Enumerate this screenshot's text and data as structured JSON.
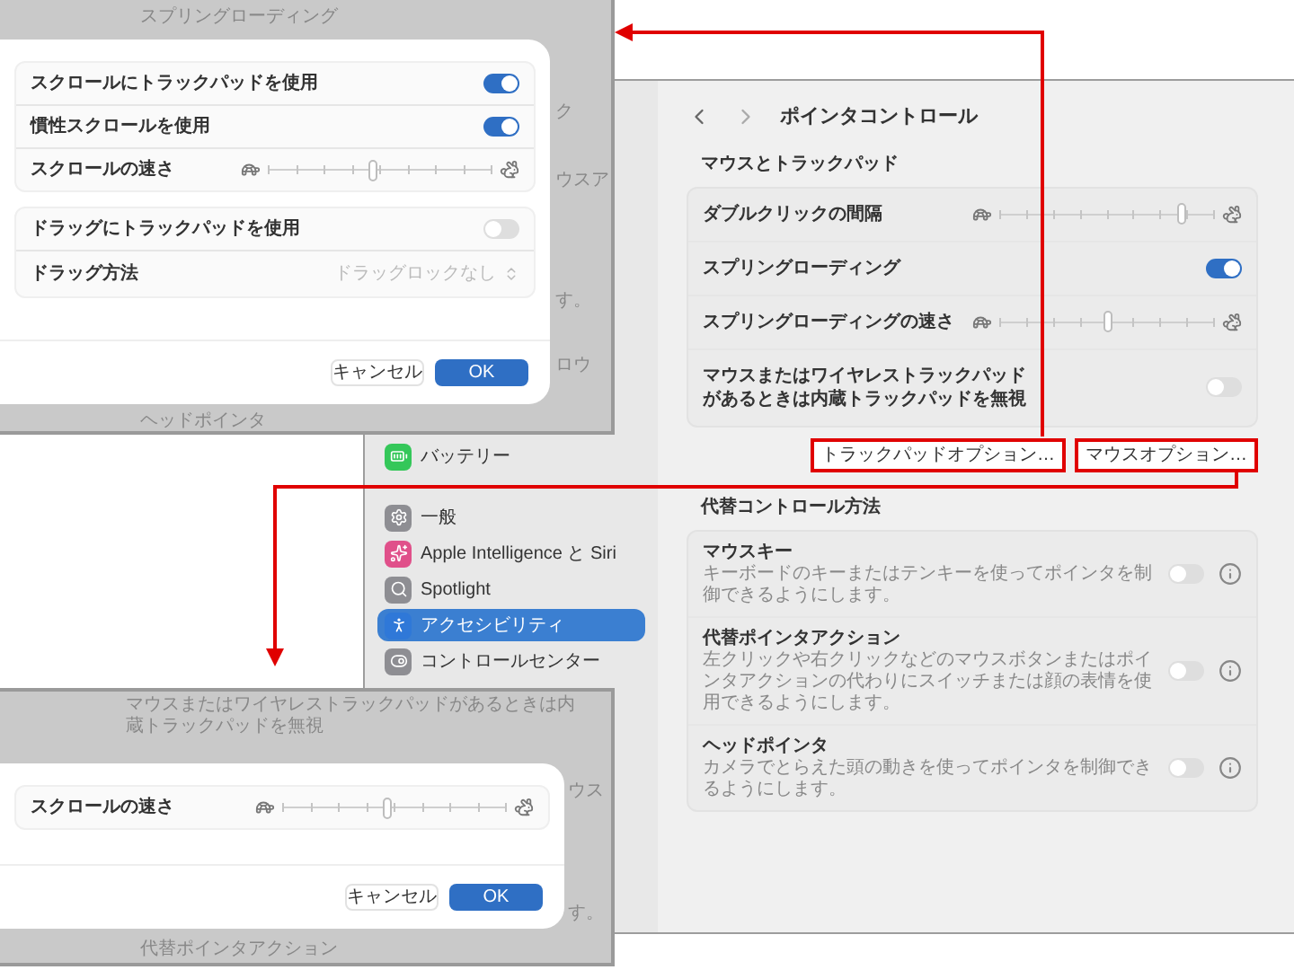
{
  "top_window": {
    "backdrop": {
      "header": "スプリングローディング",
      "fragments": [
        "ク",
        "ウスア",
        "す。",
        "ロウ"
      ],
      "footer": "ヘッドポインタ"
    },
    "sheet": {
      "groups": [
        [
          {
            "kind": "toggle",
            "label": "スクロールにトラックパッドを使用",
            "on": true
          },
          {
            "kind": "toggle",
            "label": "慣性スクロールを使用",
            "on": true
          },
          {
            "kind": "slider",
            "label": "スクロールの速さ",
            "level": 0.46
          }
        ],
        [
          {
            "kind": "toggle",
            "label": "ドラッグにトラックパッドを使用",
            "on": false
          },
          {
            "kind": "popup",
            "label": "ドラッグ方法",
            "value": "ドラッグロックなし",
            "disabled": true
          }
        ]
      ],
      "buttons": [
        {
          "label": "キャンセル",
          "kind": "secondary"
        },
        {
          "label": "OK",
          "kind": "primary"
        }
      ]
    }
  },
  "main_window": {
    "sidebar": [
      {
        "label": "バッテリー",
        "selected": false
      },
      {
        "label": "一般",
        "selected": false
      },
      {
        "label": "Apple Intelligence と Siri",
        "selected": false
      },
      {
        "label": "Spotlight",
        "selected": false
      },
      {
        "label": "アクセシビリティ",
        "selected": true
      },
      {
        "label": "コントロールセンター",
        "selected": false
      }
    ],
    "title": "ポインタコントロール",
    "sections": [
      {
        "heading": "マウスとトラックパッド",
        "rows": [
          {
            "kind": "slider",
            "label": "ダブルクリックの間隔",
            "level": 0.84
          },
          {
            "kind": "toggle",
            "label": "スプリングローディング",
            "on": true
          },
          {
            "kind": "slider",
            "label": "スプリングローディングの速さ",
            "level": 0.5
          },
          {
            "kind": "toggle",
            "label": "マウスまたはワイヤレストラックパッドがあるときは内蔵トラックパッドを無視",
            "on": false
          }
        ],
        "buttons": [
          {
            "label": "トラックパッドオプション…",
            "highlighted": true
          },
          {
            "label": "マウスオプション…",
            "highlighted": true
          }
        ]
      },
      {
        "heading": "代替コントロール方法",
        "rows": [
          {
            "kind": "toggle_info",
            "label": "マウスキー",
            "description": "キーボードのキーまたはテンキーを使ってポインタを制御できるようにします。",
            "on": false
          },
          {
            "kind": "toggle_info",
            "label": "代替ポインタアクション",
            "description": "左クリックや右クリックなどのマウスボタンまたはポインタアクションの代わりにスイッチまたは顔の表情を使用できるようにします。",
            "on": false
          },
          {
            "kind": "toggle_info",
            "label": "ヘッドポインタ",
            "description": "カメラでとらえた頭の動きを使ってポインタを制御できるようにします。",
            "on": false
          }
        ]
      }
    ]
  },
  "bottom_window": {
    "backdrop": {
      "header": "マウスまたはワイヤレストラックパッドがあるときは内蔵トラックパッドを無視",
      "fragments": [
        "ウス",
        "す。"
      ],
      "footer": "代替ポインタアクション"
    },
    "sheet": {
      "groups": [
        [
          {
            "kind": "slider",
            "label": "スクロールの速さ",
            "level": 0.46
          }
        ]
      ],
      "buttons": [
        {
          "label": "キャンセル",
          "kind": "secondary"
        },
        {
          "label": "OK",
          "kind": "primary"
        }
      ]
    }
  }
}
